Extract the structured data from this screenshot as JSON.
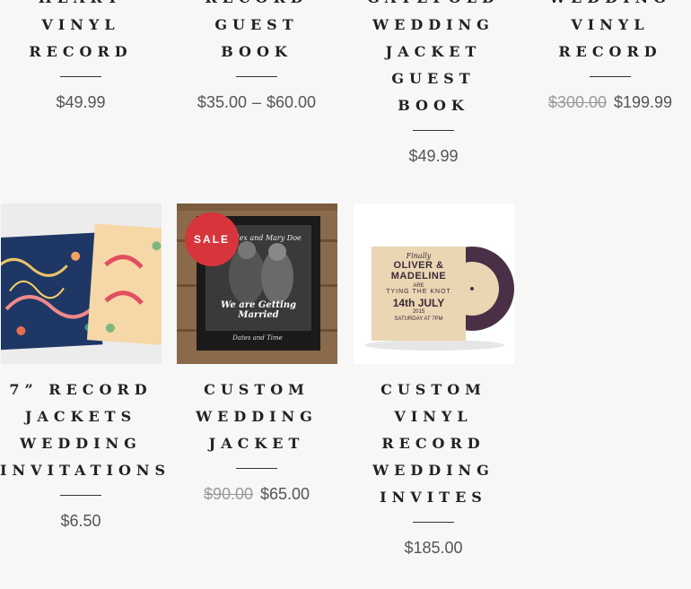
{
  "products_top": [
    {
      "title_lines": [
        "HEART",
        "VINYL",
        "RECORD"
      ],
      "price_regular": "$49.99"
    },
    {
      "title_lines": [
        "RECORD",
        "GUEST",
        "BOOK"
      ],
      "price_from": "$35.00",
      "price_sep": "–",
      "price_to": "$60.00"
    },
    {
      "title_lines": [
        "GATEFOLD",
        "WEDDING",
        "JACKET",
        "GUEST",
        "BOOK"
      ],
      "price_regular": "$49.99"
    },
    {
      "title_lines": [
        "WEDDING",
        "VINYL",
        "RECORD"
      ],
      "price_old": "$300.00",
      "price_new": "$199.99"
    }
  ],
  "products_bottom": [
    {
      "title_lines": [
        "7” RECORD",
        "JACKETS",
        "WEDDING",
        "INVITATIONS"
      ],
      "price_regular": "$6.50",
      "image_name": "record-jackets-image"
    },
    {
      "title_lines": [
        "CUSTOM",
        "WEDDING",
        "JACKET"
      ],
      "price_old": "$90.00",
      "price_new": "$65.00",
      "badge": "SALE",
      "image_name": "wedding-jacket-image",
      "image_caption": "We are Getting Married",
      "image_header": "Alex and Mary Doe",
      "image_footer": "Dates and Time"
    },
    {
      "title_lines": [
        "CUSTOM",
        "VINYL",
        "RECORD",
        "WEDDING",
        "INVITES"
      ],
      "price_regular": "$185.00",
      "image_name": "vinyl-invite-image",
      "card_lines": [
        "Finally",
        "OLIVER & MADELINE",
        "ARE",
        "TYING THE KNOT",
        "14th JULY",
        "2015",
        "SATURDAY AT 7PM"
      ]
    }
  ],
  "colors": {
    "sale": "#d7353c",
    "background": "#f7f7f8"
  }
}
